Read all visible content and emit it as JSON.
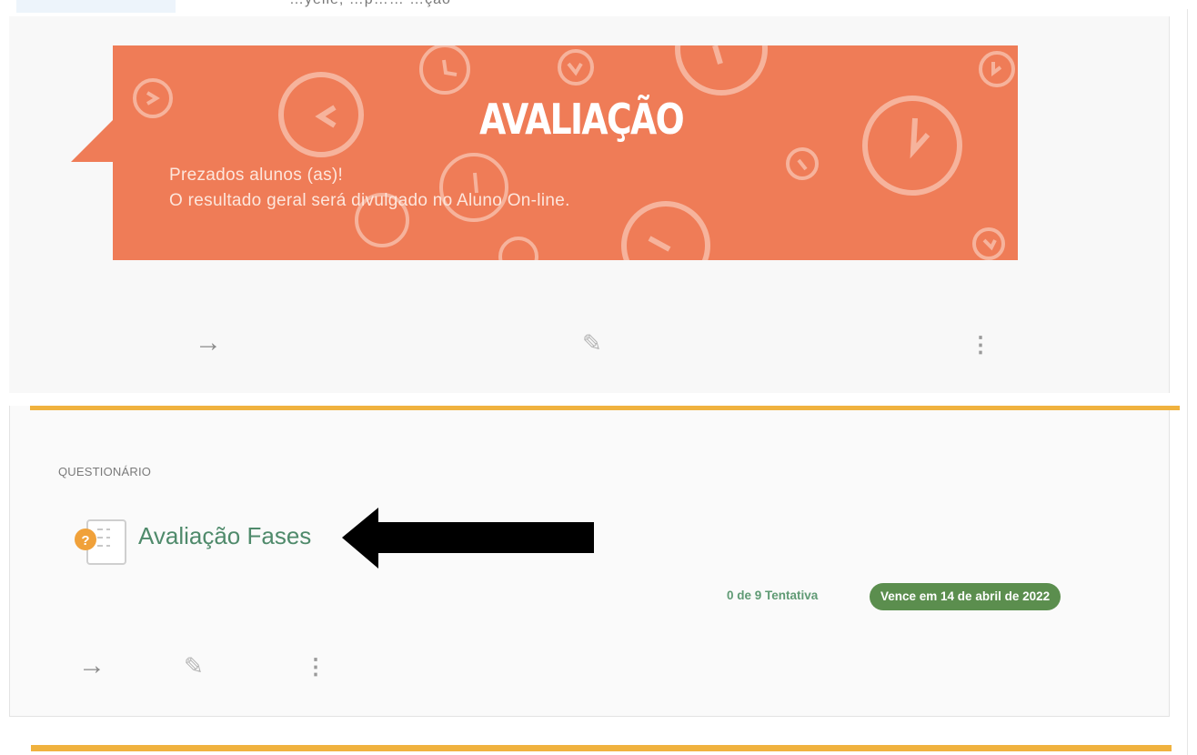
{
  "header": {
    "partial_text": "…yelle, …p…… …ção"
  },
  "banner": {
    "title": "AVALIAÇÃO",
    "line1": "Prezados alunos (as)!",
    "line2": "O resultado geral será divulgado no Aluno On-line.",
    "color": "#ef7c57"
  },
  "card1": {
    "actions": {
      "open_icon": "arrow-right-icon",
      "edit_icon": "pencil-icon",
      "more_icon": "kebab-icon"
    }
  },
  "card2": {
    "type_label": "QUESTIONÁRIO",
    "title": "Avaliação Fases",
    "attempts": "0 de 9 Tentativa",
    "due": "Vence em 14 de abril de 2022",
    "accent_color": "#f0b23e",
    "badge_color": "#5b8e4e"
  },
  "icons": {
    "arrow": "→",
    "pencil": "✎",
    "kebab": "⋮"
  }
}
